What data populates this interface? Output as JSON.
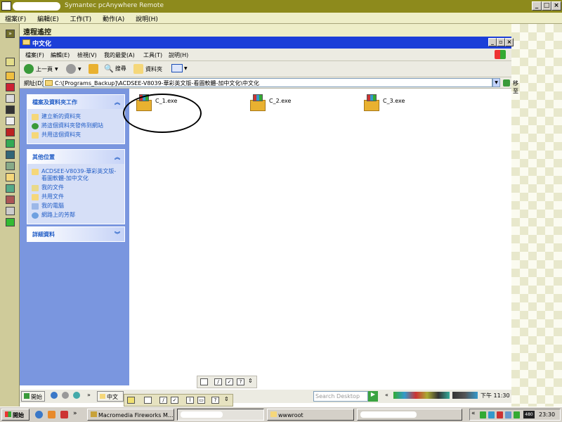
{
  "outer_window": {
    "title": "Symantec pcAnywhere Remote",
    "menu": [
      "檔案(F)",
      "編輯(E)",
      "工作(T)",
      "動作(A)",
      "說明(H)"
    ],
    "remote_label": "遠程遙控"
  },
  "explorer": {
    "title": "中文化",
    "menu": [
      "檔案(F)",
      "編輯(E)",
      "檢視(V)",
      "我的最愛(A)",
      "工具(T)",
      "說明(H)"
    ],
    "toolbar": {
      "back": "上一頁",
      "search": "搜尋",
      "folders": "資料夾"
    },
    "address": {
      "label": "網址(D)",
      "value": "C:\\[Programs_Backup]\\ACDSEE-V8039-華彩英文版-看圖軟體-加中文化\\中文化",
      "go": "移至"
    },
    "panels": [
      {
        "title": "檔案及資料夾工作",
        "items": [
          "建立新的資料夾",
          "將這個資料夾發佈到網站",
          "共用這個資料夾"
        ]
      },
      {
        "title": "其他位置",
        "items": [
          "ACDSEE-V8039-華彩英文版-看圖軟體-加中文化",
          "我的文件",
          "共用文件",
          "我的電腦",
          "網路上的芳鄰"
        ]
      },
      {
        "title": "詳細資料",
        "items": []
      }
    ],
    "files": [
      {
        "name": "C_1.exe"
      },
      {
        "name": "C_2.exe"
      },
      {
        "name": "C_3.exe"
      }
    ]
  },
  "remote_taskbar": {
    "start": "開始",
    "window_button": "中文",
    "search_placeholder": "Search Desktop",
    "clock": "下午 11:30"
  },
  "local_taskbar": {
    "start": "開始",
    "task_fireworks": "Macromedia Fireworks M...",
    "task_wwwroot": "wwwroot",
    "clock": "23:30",
    "tray_number": "480"
  },
  "colors": {
    "outer_title": "#8d8a1c",
    "explorer_title": "#1c3fd8",
    "task_pane": "#7a96df"
  }
}
